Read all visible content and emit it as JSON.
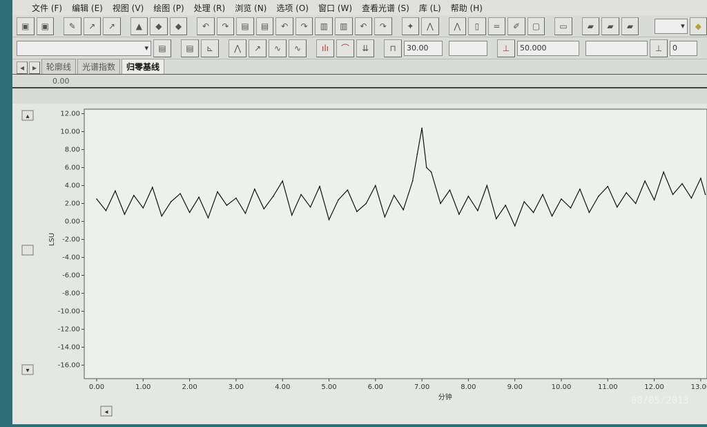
{
  "menu": [
    "文件 (F)",
    "编辑 (E)",
    "视图 (V)",
    "绘图 (P)",
    "处理 (R)",
    "浏览 (N)",
    "选项 (O)",
    "窗口 (W)",
    "查看光谱 (S)",
    "库 (L)",
    "帮助 (H)"
  ],
  "toolbar2": {
    "field1": "30.00",
    "field2": "50.000",
    "field3": "0"
  },
  "tabs": [
    "轮廓线",
    "光谱指数",
    "归零基线"
  ],
  "active_tab": "归零基线",
  "subbar_value": "0.00",
  "photo_date": "08/05/2013",
  "chart_data": {
    "type": "line",
    "xlabel": "分钟",
    "ylabel": "LSU",
    "xlim": [
      0,
      13.1
    ],
    "ylim": [
      -17.5,
      12.5
    ],
    "xticks": [
      "0.00",
      "1.00",
      "2.00",
      "3.00",
      "4.00",
      "5.00",
      "6.00",
      "7.00",
      "8.00",
      "9.00",
      "10.00",
      "11.00",
      "12.00",
      "13.00"
    ],
    "yticks": [
      "12.00",
      "10.00",
      "8.00",
      "6.00",
      "4.00",
      "2.00",
      "0.00",
      "-2.00",
      "-4.00",
      "-6.00",
      "-8.00",
      "-10.00",
      "-12.00",
      "-14.00",
      "-16.00"
    ],
    "color": "#111111",
    "x": [
      0,
      0.2,
      0.4,
      0.6,
      0.8,
      1.0,
      1.2,
      1.4,
      1.6,
      1.8,
      2.0,
      2.2,
      2.4,
      2.6,
      2.8,
      3.0,
      3.2,
      3.4,
      3.6,
      3.8,
      4.0,
      4.2,
      4.4,
      4.6,
      4.8,
      5.0,
      5.2,
      5.4,
      5.6,
      5.8,
      6.0,
      6.2,
      6.4,
      6.6,
      6.8,
      6.9,
      7.0,
      7.1,
      7.2,
      7.4,
      7.6,
      7.8,
      8.0,
      8.2,
      8.4,
      8.6,
      8.8,
      9.0,
      9.2,
      9.4,
      9.6,
      9.8,
      10.0,
      10.2,
      10.4,
      10.6,
      10.8,
      11.0,
      11.2,
      11.4,
      11.6,
      11.8,
      12.0,
      12.2,
      12.4,
      12.6,
      12.8,
      13.0,
      13.1
    ],
    "y": [
      2.5,
      1.2,
      3.4,
      0.8,
      2.9,
      1.5,
      3.8,
      0.6,
      2.2,
      3.1,
      1.0,
      2.7,
      0.4,
      3.3,
      1.8,
      2.6,
      0.9,
      3.6,
      1.4,
      2.8,
      4.5,
      0.7,
      3.0,
      1.6,
      3.9,
      0.2,
      2.4,
      3.5,
      1.1,
      2.0,
      4.0,
      0.5,
      2.9,
      1.3,
      4.5,
      7.5,
      10.4,
      6.0,
      5.5,
      2.0,
      3.5,
      0.8,
      2.8,
      1.2,
      4.0,
      0.3,
      1.8,
      -0.5,
      2.2,
      1.0,
      3.0,
      0.6,
      2.5,
      1.5,
      3.6,
      1.0,
      2.8,
      3.9,
      1.6,
      3.2,
      2.0,
      4.5,
      2.4,
      5.5,
      3.0,
      4.2,
      2.6,
      4.8,
      3.0
    ]
  }
}
